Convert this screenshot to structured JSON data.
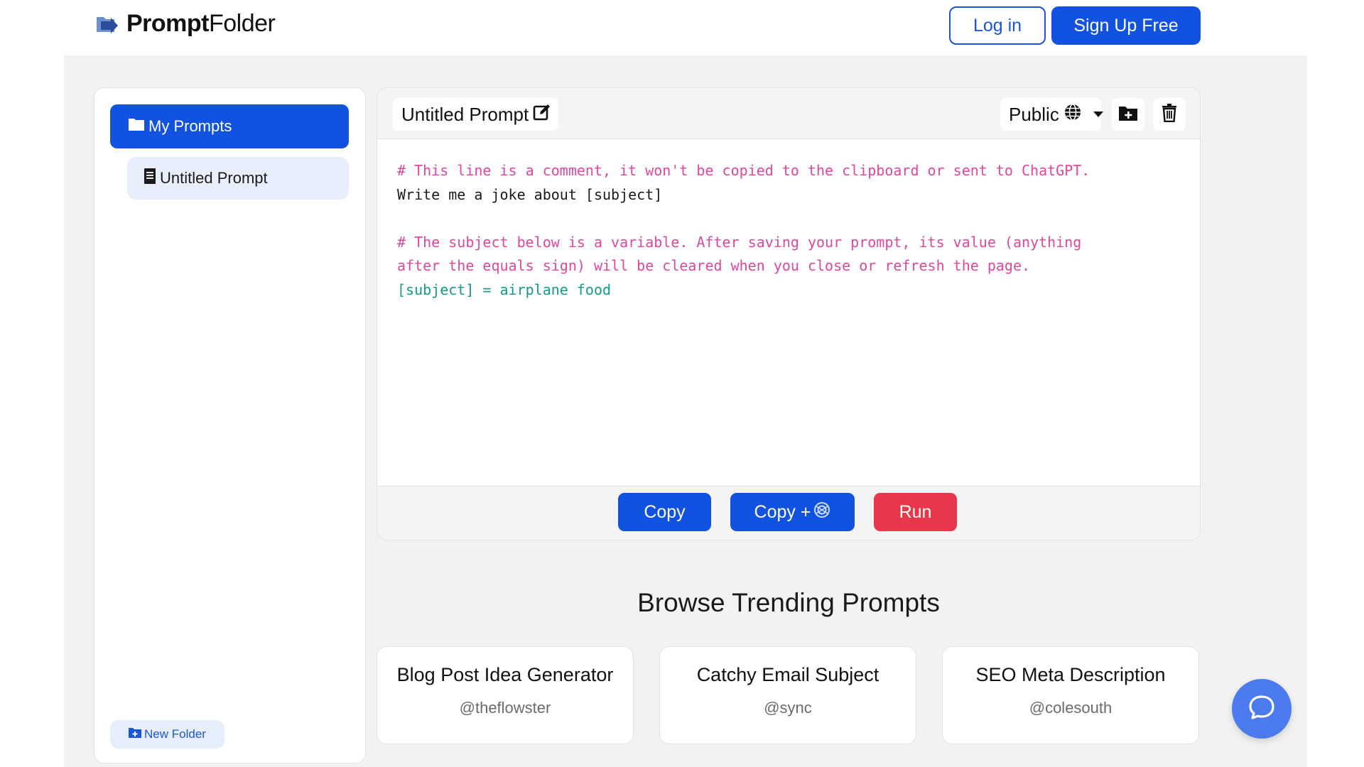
{
  "header": {
    "logo_bold": "Prompt",
    "logo_light": "Folder",
    "login_label": "Log in",
    "signup_label": "Sign Up Free"
  },
  "sidebar": {
    "folder_label": "My Prompts",
    "prompt_label": "Untitled Prompt",
    "new_folder_label": "New Folder"
  },
  "editor": {
    "title": "Untitled Prompt",
    "visibility": "Public",
    "lines": [
      {
        "type": "comment",
        "text": "# This line is a comment, it won't be copied to the clipboard or sent to ChatGPT."
      },
      {
        "type": "text",
        "text": "Write me a joke about [subject]"
      },
      {
        "type": "blank",
        "text": " "
      },
      {
        "type": "comment",
        "text": "# The subject below is a variable. After saving your prompt, its value (anything"
      },
      {
        "type": "comment",
        "text": "after the equals sign) will be cleared when you close or refresh the page."
      },
      {
        "type": "var",
        "text": "[subject] = airplane food"
      }
    ],
    "copy_label": "Copy",
    "copy_gpt_label": "Copy +",
    "run_label": "Run"
  },
  "trending": {
    "title": "Browse Trending Prompts",
    "cards": [
      {
        "title": "Blog Post Idea Generator",
        "user": "@theflowster"
      },
      {
        "title": "Catchy Email Subject",
        "user": "@sync"
      },
      {
        "title": "SEO Meta Description",
        "user": "@colesouth"
      }
    ]
  },
  "colors": {
    "primary": "#1153e0",
    "danger": "#e8374a",
    "comment": "#e0479e",
    "variable": "#159a8c",
    "chat": "#4b7bef"
  }
}
